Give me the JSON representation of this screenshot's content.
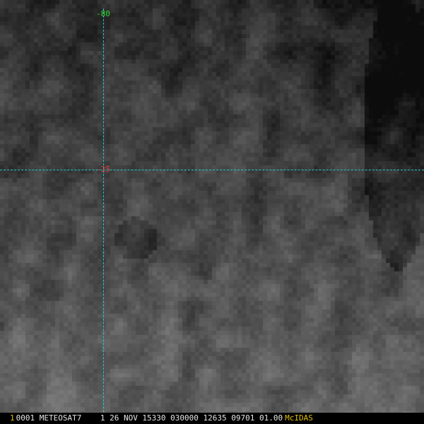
{
  "overlay": {
    "longitude_label": "-80",
    "latitude_label": "-25"
  },
  "status_bar": {
    "frame_number": "1",
    "info_text": "0001 METEOSAT7    1 26 NOV 15330 030000 12635 09701 01.00",
    "brand": "McIDAS"
  },
  "colors": {
    "grid_line": "#22c8c8",
    "longitude_label": "#33dd33",
    "latitude_label": "#dd3333",
    "frame_number": "#e0c000",
    "brand": "#e0c000",
    "status_text": "#e6e6e6"
  },
  "imagery": {
    "description_type": "satellite-water-vapor-grayscale"
  }
}
